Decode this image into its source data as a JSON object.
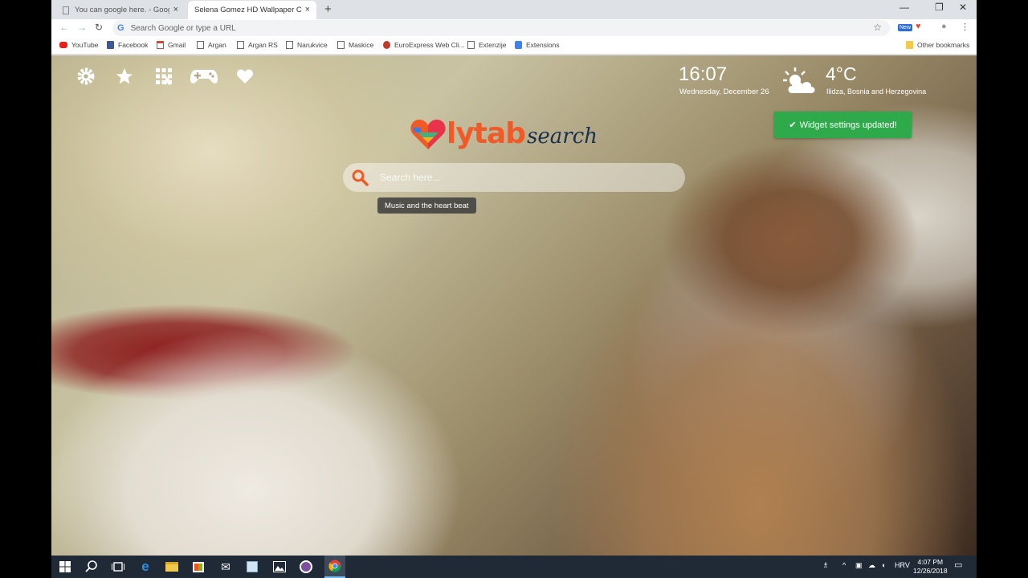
{
  "browser": {
    "tabs": [
      {
        "title": "You can google here. - Google Chrome",
        "active": false
      },
      {
        "title": "Selena Gomez HD Wallpaper Chrome Extension",
        "active": true
      }
    ],
    "new_tab_label": "+",
    "close_glyph": "×",
    "omnibox_placeholder": "Search Google or type a URL",
    "omnibox_g": "G",
    "bookmarks": [
      {
        "label": "YouTube",
        "icon": "youtube-icon"
      },
      {
        "label": "Facebook",
        "icon": "facebook-icon"
      },
      {
        "label": "Gmail",
        "icon": "gmail-icon"
      },
      {
        "label": "Argan",
        "icon": "page-icon"
      },
      {
        "label": "Argan RS",
        "icon": "page-icon"
      },
      {
        "label": "Narukvice",
        "icon": "page-icon"
      },
      {
        "label": "Maskice",
        "icon": "page-icon"
      },
      {
        "label": "EuroExpress Web Cli...",
        "icon": "euroexpress-icon"
      },
      {
        "label": "Extenzije",
        "icon": "page-icon"
      },
      {
        "label": "Extensions",
        "icon": "puzzle-icon"
      }
    ],
    "other_bookmarks": "Other bookmarks",
    "ext_badge": "New"
  },
  "newtab": {
    "clock": "16:07",
    "date": "Wednesday, December 26",
    "temperature": "4°C",
    "location": "Ilidza, Bosnia and Herzegovina",
    "toast": "Widget settings updated!",
    "logo_main": "lytab",
    "logo_search": "search",
    "search_placeholder": "Search here...",
    "suggestion": "Music and the heart beat"
  },
  "taskbar": {
    "language": "HRV",
    "time": "4:07 PM",
    "date": "12/26/2018"
  },
  "colors": {
    "accent_orange": "#f05a28",
    "toast_green": "#2eaa4a",
    "taskbar": "#1f2a36"
  }
}
